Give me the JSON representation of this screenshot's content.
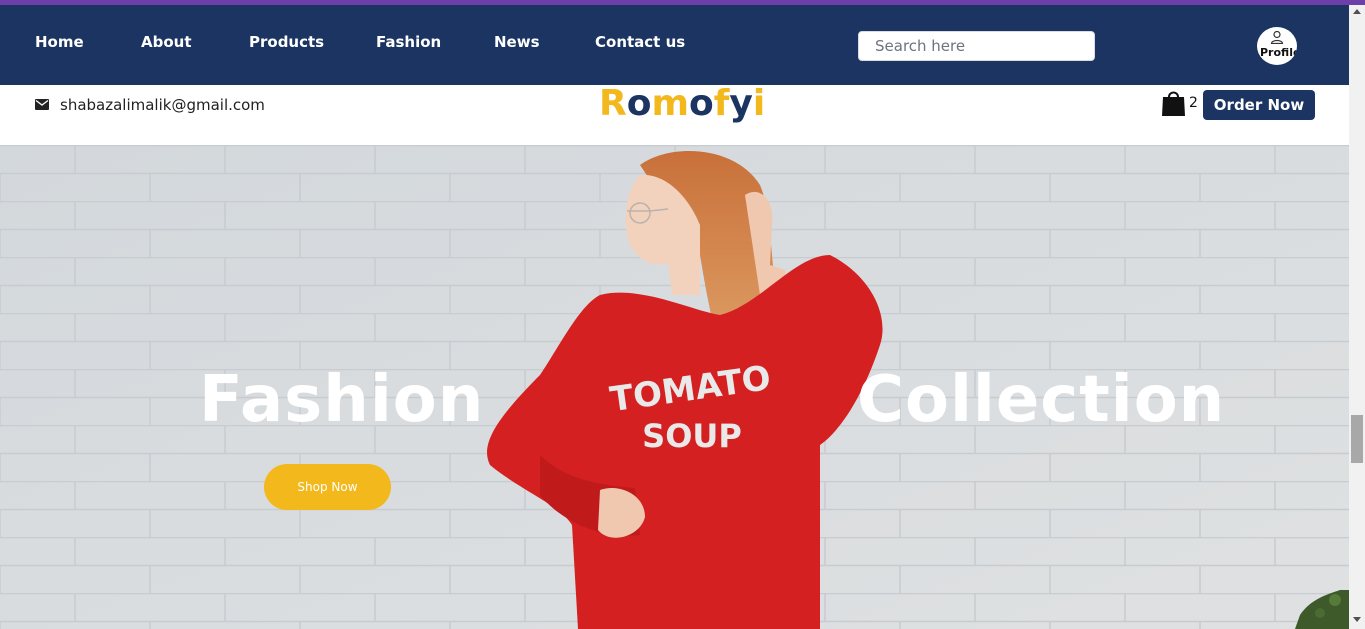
{
  "nav": {
    "items": [
      {
        "label": "Home"
      },
      {
        "label": "About"
      },
      {
        "label": "Products"
      },
      {
        "label": "Fashion"
      },
      {
        "label": "News"
      },
      {
        "label": "Contact us"
      }
    ],
    "search_placeholder": "Search here",
    "profile_label": "Profile"
  },
  "info": {
    "email": "shabazalimalik@gmail.com",
    "logo_letters": [
      "R",
      "o",
      "m",
      "o",
      "f",
      "y",
      "i"
    ],
    "cart_count": "2",
    "order_label": "Order Now"
  },
  "hero": {
    "word_left": "Fashion",
    "word_right": "Collection",
    "sweatshirt_line1": "TOMATO",
    "sweatshirt_line2": "SOUP",
    "shop_label": "Shop Now"
  },
  "colors": {
    "nav_bg": "#1b3461",
    "accent": "#f3b81c",
    "top_strip": "#6d3fa8",
    "sweater": "#d42020"
  }
}
